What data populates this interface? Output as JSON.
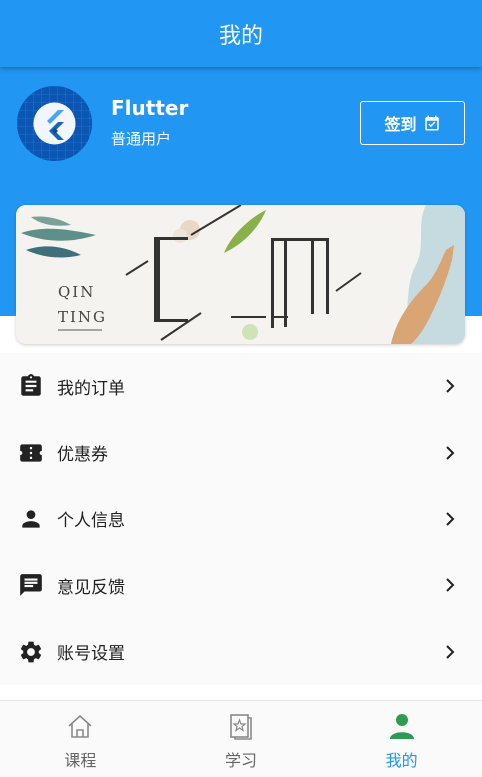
{
  "app_bar": {
    "title": "我的"
  },
  "profile": {
    "name": "Flutter",
    "user_type": "普通用户"
  },
  "signin_button": {
    "label": "签到"
  },
  "banner": {
    "line1": "QIN",
    "line2": "TING"
  },
  "menu": {
    "items": [
      {
        "label": "我的订单",
        "icon": "clipboard-icon"
      },
      {
        "label": "优惠券",
        "icon": "ticket-icon"
      },
      {
        "label": "个人信息",
        "icon": "person-icon"
      },
      {
        "label": "意见反馈",
        "icon": "feedback-icon"
      },
      {
        "label": "账号设置",
        "icon": "gear-icon"
      }
    ]
  },
  "bottom_nav": {
    "items": [
      {
        "label": "课程",
        "icon": "home-icon"
      },
      {
        "label": "学习",
        "icon": "study-icon"
      },
      {
        "label": "我的",
        "icon": "person-icon",
        "active": true
      }
    ]
  },
  "colors": {
    "primary": "#2196f3",
    "nav_active": "#2e9b50",
    "icon_dark": "#222222"
  }
}
